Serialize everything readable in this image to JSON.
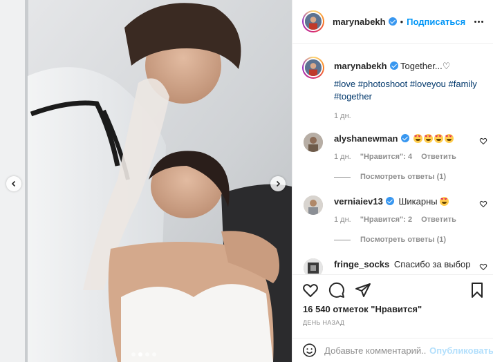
{
  "photo": {
    "alt_icons": {
      "prev": "chevron-left-icon",
      "next": "chevron-right-icon"
    },
    "carousel_dots": 4,
    "active_dot": 2
  },
  "header": {
    "username": "marynabekh",
    "separator": "•",
    "follow_label": "Подписаться"
  },
  "caption": {
    "username": "marynabekh",
    "text": "Together...♡",
    "tags": "#love #photoshoot #loveyou #family #together",
    "time": "1 дн."
  },
  "comments": [
    {
      "username": "alyshanewman",
      "text": "",
      "emoji_count": 4,
      "time": "1 дн.",
      "likes": "\"Нравится\": 4",
      "reply": "Ответить",
      "view_replies": "Посмотреть ответы (1)"
    },
    {
      "username": "verniaiev13",
      "text": "Шикарны",
      "emoji_count": 1,
      "time": "1 дн.",
      "likes": "\"Нравится\": 2",
      "reply": "Ответить",
      "view_replies": "Посмотреть ответы (1)"
    },
    {
      "username": "fringe_socks",
      "text": "Спасибо за выбор"
    }
  ],
  "actions": {
    "like_count": "16 540 отметок \"Нравится\"",
    "posted": "ДЕНЬ НАЗАД"
  },
  "add_comment": {
    "placeholder": "Добавьте комментарий...",
    "publish_label": "Опубликовать"
  },
  "colors": {
    "accent": "#0095f6",
    "verified": "#3897f0",
    "muted": "#8e8e8e",
    "publish_disabled": "#b2dffc"
  }
}
